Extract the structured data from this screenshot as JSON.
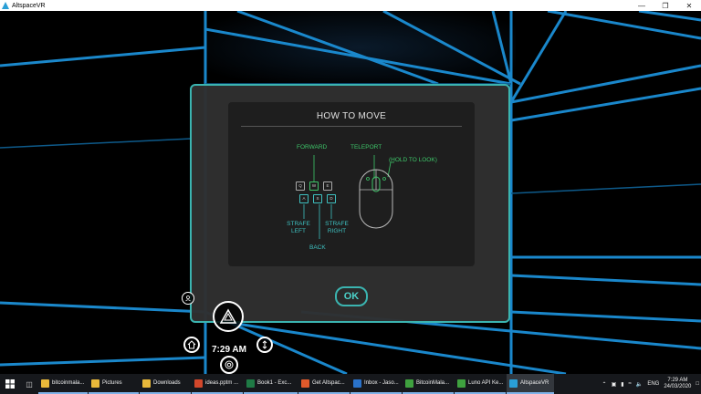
{
  "window": {
    "title": "AltspaceVR"
  },
  "dialog": {
    "title": "HOW TO MOVE",
    "labels": {
      "forward": "FORWARD",
      "teleport": "TELEPORT",
      "hold_to_look": "(HOLD TO LOOK)",
      "strafe_left_1": "STRAFE",
      "strafe_left_2": "LEFT",
      "strafe_right_1": "STRAFE",
      "strafe_right_2": "RIGHT",
      "back": "BACK"
    },
    "keys": {
      "q": "Q",
      "w": "W",
      "e": "E",
      "a": "A",
      "s": "S",
      "d": "D"
    },
    "ok_label": "OK"
  },
  "hud": {
    "time": "7:29 AM"
  },
  "taskbar": {
    "apps": [
      {
        "label": "bitcoinmala...",
        "color": "#e8b83a",
        "state": "open"
      },
      {
        "label": "Pictures",
        "color": "#e8b83a",
        "state": "open"
      },
      {
        "label": "Downloads",
        "color": "#e8b83a",
        "state": "open"
      },
      {
        "label": "ideas.pptm ...",
        "color": "#d2472b",
        "state": "open"
      },
      {
        "label": "Book1 - Exc...",
        "color": "#1f7a45",
        "state": "open"
      },
      {
        "label": "Get Altspac...",
        "color": "#e05a2b",
        "state": "open"
      },
      {
        "label": "Inbox - Jaso...",
        "color": "#2a72c9",
        "state": "open"
      },
      {
        "label": "BitcoinMala...",
        "color": "#3fa13f",
        "state": "open"
      },
      {
        "label": "Luno API Ke...",
        "color": "#3fa13f",
        "state": "open"
      },
      {
        "label": "AltspaceVR",
        "color": "#2a9fd6",
        "state": "active"
      }
    ],
    "tray": {
      "language": "ENG",
      "time": "7:29 AM",
      "date": "24/03/2020"
    }
  },
  "colors": {
    "accent": "#3bb4b0",
    "grid": "#1c8fd6",
    "green": "#3ec76a"
  }
}
